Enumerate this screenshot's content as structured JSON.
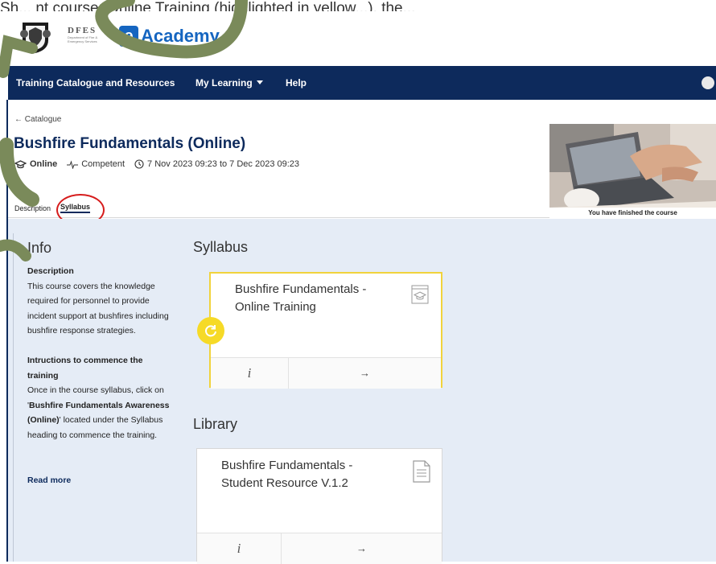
{
  "top_fragment": "Sh... nt course: Online Training (highlighted in yellow...),   the...",
  "header": {
    "agency_acronym": "DFES",
    "agency_subtitle": "Department of Fire & Emergency Services",
    "brand_letter": "e",
    "brand_name": "Academy"
  },
  "nav": {
    "items": [
      "Training Catalogue and Resources",
      "My Learning",
      "Help"
    ]
  },
  "course": {
    "back_label": "Catalogue",
    "title": "Bushfire Fundamentals (Online)",
    "delivery": "Online",
    "status": "Competent",
    "dates": "7 Nov 2023 09:23 to 7 Dec 2023 09:23",
    "tabs": [
      "Description",
      "Syllabus"
    ],
    "active_tab": "Syllabus",
    "image_caption": "You have finished the course"
  },
  "info": {
    "title": "Info",
    "description_heading": "Description",
    "description_text": "This course covers the knowledge required for personnel to provide incident support at bushfires including bushfire response strategies.",
    "instructions_heading": "Intructions to commence the training",
    "instructions_pre": "Once in the course syllabus, click on '",
    "instructions_bold": "Bushfire Fundamentals Awareness (Online)",
    "instructions_post": "' located under the Syllabus heading to commence the training.",
    "read_more": "Read more"
  },
  "syllabus": {
    "title": "Syllabus",
    "card": {
      "title": "Bushfire Fundamentals - Online Training",
      "info_label": "i",
      "arrow_label": "→"
    }
  },
  "library": {
    "title": "Library",
    "card": {
      "title": "Bushfire Fundamentals - Student Resource V.1.2",
      "info_label": "i",
      "arrow_label": "→"
    }
  },
  "colors": {
    "nav_bg": "#0d2a5c",
    "brand_blue": "#1565c0",
    "content_bg": "#e5ecf6",
    "highlight_border": "#f1d33c",
    "annotation_red": "#d61c1c",
    "annotation_green": "#7a8a5a"
  }
}
